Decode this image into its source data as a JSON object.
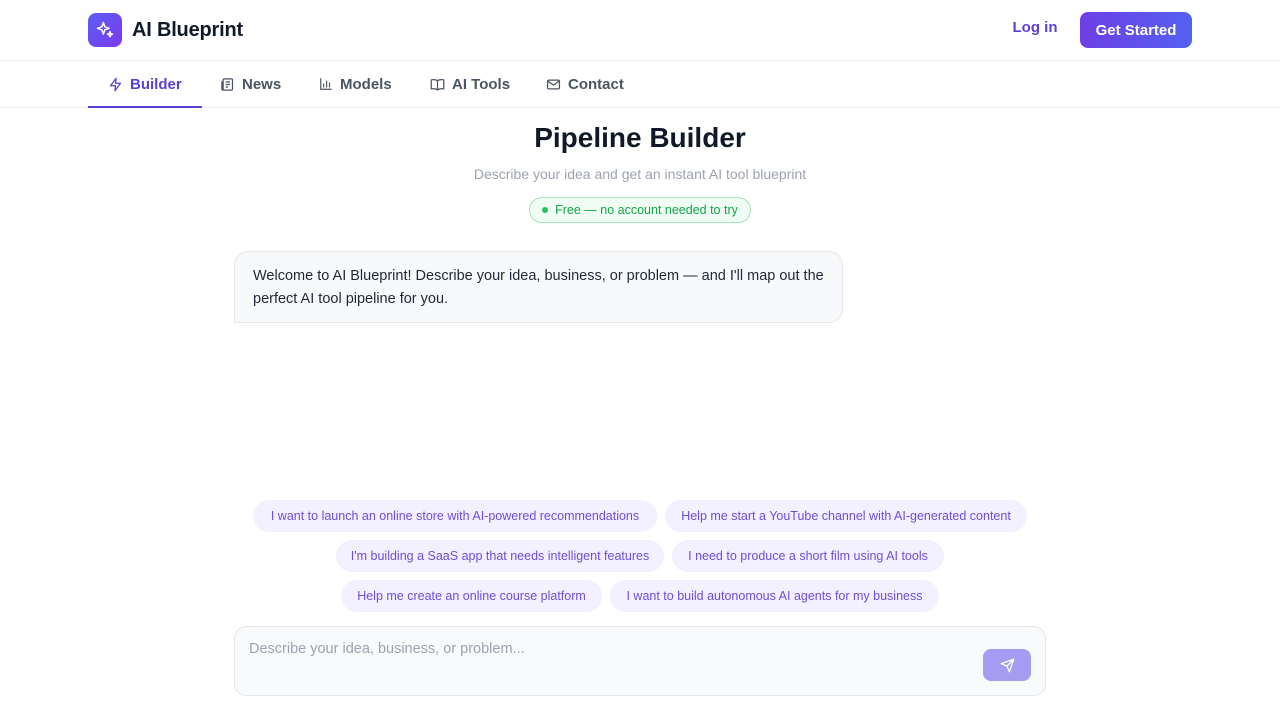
{
  "header": {
    "brand": "AI Blueprint",
    "login_label": "Log in",
    "cta_label": "Get Started"
  },
  "nav": {
    "tabs": [
      {
        "label": "Builder",
        "icon": "bolt-icon",
        "active": true
      },
      {
        "label": "News",
        "icon": "newspaper-icon",
        "active": false
      },
      {
        "label": "Models",
        "icon": "bar-chart-icon",
        "active": false
      },
      {
        "label": "AI Tools",
        "icon": "book-icon",
        "active": false
      },
      {
        "label": "Contact",
        "icon": "mail-icon",
        "active": false
      }
    ]
  },
  "main": {
    "title": "Pipeline Builder",
    "subtitle": "Describe your idea and get an instant AI tool blueprint",
    "badge": "Free — no account needed to try",
    "welcome_message": "Welcome to AI Blueprint! Describe your idea, business, or problem — and I'll map out the perfect AI tool pipeline for you."
  },
  "suggestions": [
    "I want to launch an online store with AI-powered recommendations",
    "Help me start a YouTube channel with AI-generated content",
    "I'm building a SaaS app that needs intelligent features",
    "I need to produce a short film using AI tools",
    "Help me create an online course platform",
    "I want to build autonomous AI agents for my business"
  ],
  "composer": {
    "placeholder": "Describe your idea, business, or problem...",
    "value": ""
  },
  "colors": {
    "accent": "#5b3fd6",
    "chip_bg": "#f3f0ff",
    "badge_green": "#16a34a",
    "send_button": "#a59cf2"
  }
}
